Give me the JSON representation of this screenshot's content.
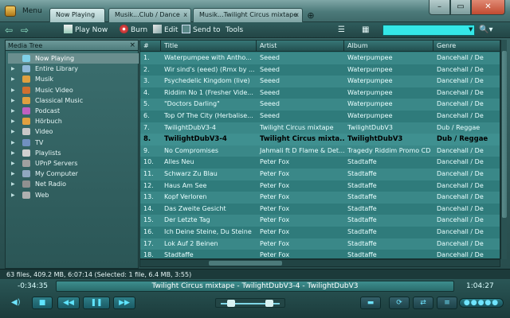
{
  "window": {
    "menu_label": "Menu",
    "tabs": [
      {
        "label": "Now Playing",
        "active": true
      },
      {
        "label": "Musik...Club / Dance",
        "active": false
      },
      {
        "label": "Musik...Twilight Circus mixtape",
        "active": false
      }
    ],
    "close_glyph": "x",
    "add_tab_glyph": "⊕",
    "min_glyph": "–",
    "max_glyph": "▭",
    "close_btn_glyph": "✕"
  },
  "toolbar": {
    "back_glyph": "⇦",
    "forward_glyph": "⇨",
    "play_now": "Play Now",
    "burn": "Burn",
    "edit": "Edit",
    "send_to": "Send to",
    "tools": "Tools",
    "search_placeholder": "",
    "search_glyph": "🔍▾"
  },
  "tree": {
    "title": "Media Tree",
    "close_glyph": "×",
    "items": [
      {
        "label": "Now Playing",
        "icon": "now-playing-icon",
        "color": "#7fd0e8",
        "selected": true
      },
      {
        "label": "Entire Library",
        "icon": "library-icon",
        "color": "#8fb8d8"
      },
      {
        "label": "Musik",
        "icon": "music-icon",
        "color": "#e0a040"
      },
      {
        "label": "Music Video",
        "icon": "music-video-icon",
        "color": "#d07030"
      },
      {
        "label": "Classical Music",
        "icon": "classical-icon",
        "color": "#e0a040"
      },
      {
        "label": "Podcast",
        "icon": "podcast-icon",
        "color": "#c060c0"
      },
      {
        "label": "Hörbuch",
        "icon": "audiobook-icon",
        "color": "#e0a040"
      },
      {
        "label": "Video",
        "icon": "video-icon",
        "color": "#c8c8c8"
      },
      {
        "label": "TV",
        "icon": "tv-icon",
        "color": "#7090c0"
      },
      {
        "label": "Playlists",
        "icon": "playlist-icon",
        "color": "#d0d0d0"
      },
      {
        "label": "UPnP Servers",
        "icon": "server-icon",
        "color": "#a0a0a0"
      },
      {
        "label": "My Computer",
        "icon": "computer-icon",
        "color": "#90a8c0"
      },
      {
        "label": "Net Radio",
        "icon": "radio-icon",
        "color": "#909090"
      },
      {
        "label": "Web",
        "icon": "globe-icon",
        "color": "#b0b0b0"
      }
    ]
  },
  "list": {
    "columns": [
      "#",
      "Title",
      "Artist",
      "Album",
      "Genre"
    ],
    "rows": [
      {
        "n": "1.",
        "title": "Waterpumpee with Antho...",
        "artist": "Seeed",
        "album": "Waterpumpee",
        "genre": "Dancehall / De"
      },
      {
        "n": "2.",
        "title": "Wir sind's (eeed) (Rmx by ...",
        "artist": "Seeed",
        "album": "Waterpumpee",
        "genre": "Dancehall / De"
      },
      {
        "n": "3.",
        "title": "Psychedelic Kingdom (live)",
        "artist": "Seeed",
        "album": "Waterpumpee",
        "genre": "Dancehall / De"
      },
      {
        "n": "4.",
        "title": "Riddim No 1 (Fresher Vide...",
        "artist": "Seeed",
        "album": "Waterpumpee",
        "genre": "Dancehall / De"
      },
      {
        "n": "5.",
        "title": "\"Doctors Darling\"",
        "artist": "Seeed",
        "album": "Waterpumpee",
        "genre": "Dancehall / De"
      },
      {
        "n": "6.",
        "title": "Top Of The City (Herbalise...",
        "artist": "Seeed",
        "album": "Waterpumpee",
        "genre": "Dancehall / De"
      },
      {
        "n": "7.",
        "title": "TwilightDubV3-4",
        "artist": "Twilight Circus mixtape",
        "album": "TwilightDubV3",
        "genre": "Dub / Reggae"
      },
      {
        "n": "8.",
        "title": "TwilightDubV3-4",
        "artist": "Twilight Circus mixta...",
        "album": "TwilightDubV3",
        "genre": "Dub / Reggae",
        "current": true
      },
      {
        "n": "9.",
        "title": "No Compromises",
        "artist": "Jahmali ft D Flame & Det...",
        "album": "Tragedy Riddim Promo CD",
        "genre": "Dancehall / De"
      },
      {
        "n": "10.",
        "title": "Alles Neu",
        "artist": "Peter Fox",
        "album": "Stadtaffe",
        "genre": "Dancehall / De"
      },
      {
        "n": "11.",
        "title": "Schwarz Zu Blau",
        "artist": "Peter Fox",
        "album": "Stadtaffe",
        "genre": "Dancehall / De"
      },
      {
        "n": "12.",
        "title": "Haus Am See",
        "artist": "Peter Fox",
        "album": "Stadtaffe",
        "genre": "Dancehall / De"
      },
      {
        "n": "13.",
        "title": "Kopf Verloren",
        "artist": "Peter Fox",
        "album": "Stadtaffe",
        "genre": "Dancehall / De"
      },
      {
        "n": "14.",
        "title": "Das Zweite Gesicht",
        "artist": "Peter Fox",
        "album": "Stadtaffe",
        "genre": "Dancehall / De"
      },
      {
        "n": "15.",
        "title": "Der Letzte Tag",
        "artist": "Peter Fox",
        "album": "Stadtaffe",
        "genre": "Dancehall / De"
      },
      {
        "n": "16.",
        "title": "Ich Deine Steine, Du Steine",
        "artist": "Peter Fox",
        "album": "Stadtaffe",
        "genre": "Dancehall / De"
      },
      {
        "n": "17.",
        "title": "Lok Auf 2 Beinen",
        "artist": "Peter Fox",
        "album": "Stadtaffe",
        "genre": "Dancehall / De"
      },
      {
        "n": "18.",
        "title": "Stadtaffe",
        "artist": "Peter Fox",
        "album": "Stadtaffe",
        "genre": "Dancehall / De"
      }
    ]
  },
  "status": "63 files, 409.2 MB, 6:07:14 (Selected: 1 file, 6.4 MB, 3:55)",
  "player": {
    "elapsed": "-0:34:35",
    "remaining": "1:04:27",
    "now_playing": "Twilight Circus mixtape - TwilightDubV3-4 - TwilightDubV3",
    "buttons": {
      "vol": "◀)",
      "stop": "■",
      "prev": "◀◀",
      "pause": "❚❚",
      "next": "▶▶",
      "dots": "●●●●●"
    }
  }
}
